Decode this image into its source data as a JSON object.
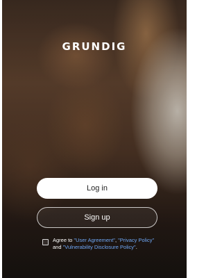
{
  "brand": {
    "logo_text": "GRUNDIG"
  },
  "buttons": {
    "login": "Log in",
    "signup": "Sign up"
  },
  "agreement": {
    "prefix": "Agree to ",
    "user_agreement": "\"User Agreement\"",
    "sep1": ", ",
    "privacy_policy": "\"Privacy Policy\"",
    "sep2": " and ",
    "vulnerability_policy": "\"Vulnerability Disclosure Policy\"",
    "suffix": ".",
    "checked": false
  },
  "colors": {
    "link": "#6fa8f7",
    "button_bg": "#ffffff"
  }
}
